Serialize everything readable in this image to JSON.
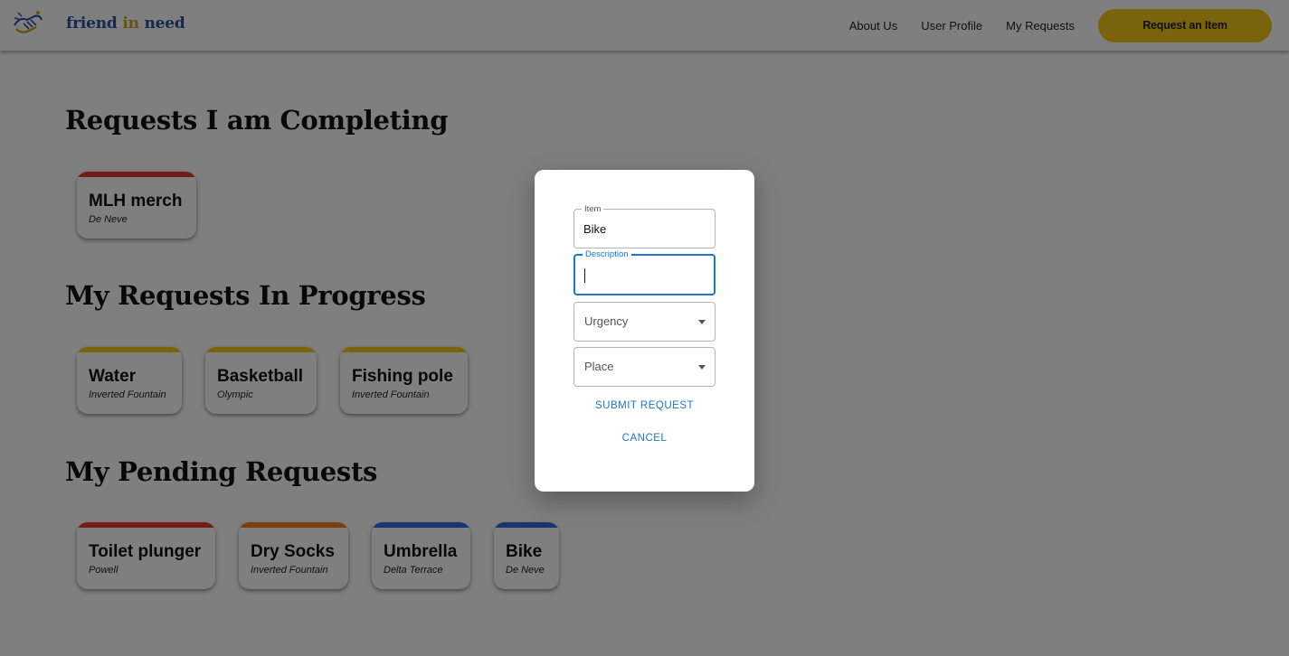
{
  "header": {
    "logo_word1": "friend",
    "logo_word2": "in",
    "logo_word3": "need",
    "nav": [
      "About Us",
      "User Profile",
      "My Requests"
    ],
    "cta_label": "Request an Item"
  },
  "sections": [
    {
      "title": "Requests I am Completing",
      "cards": [
        {
          "title": "MLH merch",
          "place": "De Neve",
          "color": "#e53935"
        }
      ]
    },
    {
      "title": "My Requests In Progress",
      "cards": [
        {
          "title": "Water",
          "place": "Inverted Fountain",
          "color": "#f2c618"
        },
        {
          "title": "Basketball",
          "place": "Olympic",
          "color": "#f2c618"
        },
        {
          "title": "Fishing pole",
          "place": "Inverted Fountain",
          "color": "#f2c618"
        }
      ]
    },
    {
      "title": "My Pending Requests",
      "cards": [
        {
          "title": "Toilet plunger",
          "place": "Powell",
          "color": "#e53935"
        },
        {
          "title": "Dry Socks",
          "place": "Inverted Fountain",
          "color": "#f57c1f"
        },
        {
          "title": "Umbrella",
          "place": "Delta Terrace",
          "color": "#2e6be0"
        },
        {
          "title": "Bike",
          "place": "De Neve",
          "color": "#2e6be0"
        }
      ]
    }
  ],
  "dialog": {
    "item_label": "Item",
    "item_value": "Bike",
    "description_label": "Description",
    "description_value": "",
    "urgency_placeholder": "Urgency",
    "place_placeholder": "Place",
    "submit_label": "SUBMIT REQUEST",
    "cancel_label": "CANCEL"
  }
}
